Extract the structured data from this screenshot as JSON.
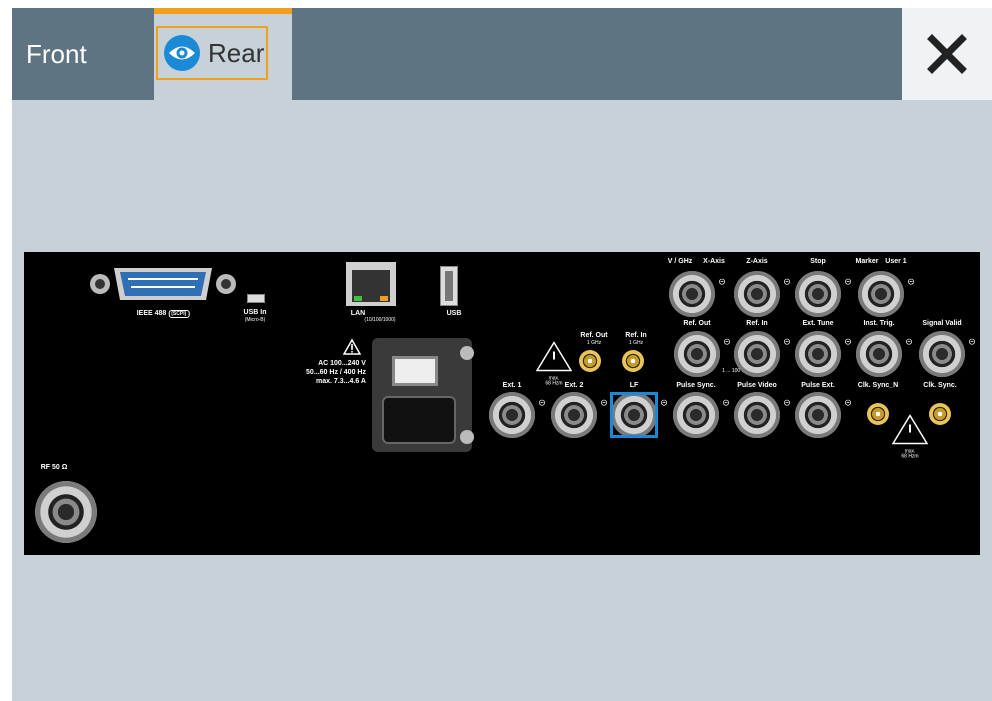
{
  "tabs": {
    "front_label": "Front",
    "rear_label": "Rear",
    "active": "Rear"
  },
  "colors": {
    "tabbar": "#5f7483",
    "accent": "#f0a01c",
    "background": "#c6d1d8",
    "selection": "#1a8ad6"
  },
  "rear_panel": {
    "ieee_label": "IEEE 488",
    "ieee_sub": "(SCPI)",
    "usb_in_label": "USB In",
    "usb_in_sub": "(Micro-B)",
    "lan_label": "LAN",
    "lan_sub": "(10/100/1000)",
    "usb_label": "USB",
    "power_line1": "AC 100...240 V",
    "power_line2": "50...60 Hz / 400 Hz",
    "power_line3": "max. 7.3...4.6 A",
    "rf_label": "RF 50 Ω",
    "warn_max1": "max.",
    "warn_max1b": "68 Hzm",
    "warn_max2": "max.",
    "warn_max2b": "68 Hzm",
    "ref_out_label": "Ref. Out",
    "ref_out_sub": "1 GHz",
    "ref_in_label": "Ref. In",
    "ref_in_sub": "1 GHz",
    "freq_range": "1 ... 100 MHz",
    "ports": [
      {
        "label": "V / GHz"
      },
      {
        "label": "X-Axis"
      },
      {
        "label": "Z-Axis"
      },
      {
        "label": "Stop"
      },
      {
        "label": "Marker"
      },
      {
        "label": "User 1"
      },
      {
        "label": "Ref. Out"
      },
      {
        "label": "Ref. In"
      },
      {
        "label": "Ext. Tune"
      },
      {
        "label": "Inst. Trig."
      },
      {
        "label": "Signal Valid"
      },
      {
        "label": "Ext. 1"
      },
      {
        "label": "Ext. 2"
      },
      {
        "label": "LF"
      },
      {
        "label": "Pulse Sync."
      },
      {
        "label": "Pulse Video"
      },
      {
        "label": "Pulse Ext."
      },
      {
        "label": "Clk. Sync_N"
      },
      {
        "label": "Clk. Sync."
      }
    ],
    "selected_port": "LF"
  }
}
